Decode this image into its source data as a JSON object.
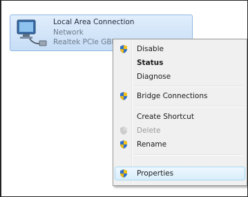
{
  "adapter": {
    "name": "Local Area Connection",
    "network": "Network",
    "device": "Realtek PCIe GBE Family Controller",
    "icon": "network-adapter-icon"
  },
  "context_menu": {
    "items": [
      {
        "label": "Disable",
        "icon": "shield-icon",
        "bold": false,
        "disabled": false
      },
      {
        "label": "Status",
        "icon": "",
        "bold": true,
        "disabled": false
      },
      {
        "label": "Diagnose",
        "icon": "",
        "bold": false,
        "disabled": false
      },
      {
        "label": "Bridge Connections",
        "icon": "shield-icon",
        "bold": false,
        "disabled": false
      },
      {
        "label": "Create Shortcut",
        "icon": "",
        "bold": false,
        "disabled": false
      },
      {
        "label": "Delete",
        "icon": "shield-icon",
        "bold": false,
        "disabled": true
      },
      {
        "label": "Rename",
        "icon": "shield-icon",
        "bold": false,
        "disabled": false
      },
      {
        "label": "Properties",
        "icon": "shield-icon",
        "bold": false,
        "disabled": false,
        "highlighted": true
      }
    ]
  },
  "colors": {
    "selection_fill": "#c6ddf6",
    "menu_background": "#f0f0f0",
    "hover_border": "#a8d8f5"
  }
}
